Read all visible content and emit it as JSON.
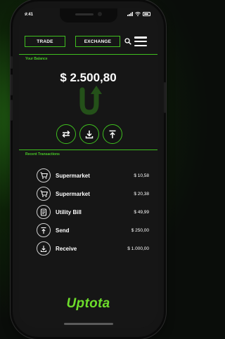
{
  "status_bar": {
    "time": "9:41",
    "signal_icon": "signal-icon",
    "wifi_icon": "wifi-icon",
    "battery_icon": "battery-icon"
  },
  "nav": {
    "trade_label": "TRADE",
    "exchange_label": "EXCHANGE",
    "search_icon": "search-icon",
    "menu_icon": "hamburger-menu-icon"
  },
  "balance": {
    "label": "Your Balance",
    "value": "$ 2.500,80"
  },
  "actions": [
    {
      "icon": "swap-arrows-icon"
    },
    {
      "icon": "download-icon"
    },
    {
      "icon": "upload-icon"
    }
  ],
  "transactions": {
    "label": "Recent Transactions",
    "items": [
      {
        "icon": "shopping-cart-icon",
        "name": "Supermarket",
        "amount": "$ 10,58"
      },
      {
        "icon": "shopping-cart-icon",
        "name": "Supermarket",
        "amount": "$ 20,38"
      },
      {
        "icon": "receipt-icon",
        "name": "Utility Bill",
        "amount": "$ 49,99"
      },
      {
        "icon": "upload-icon",
        "name": "Send",
        "amount": "$ 250,00"
      },
      {
        "icon": "download-icon",
        "name": "Receive",
        "amount": "$ 1.000,00"
      }
    ]
  },
  "brand": {
    "name": "Uptota"
  },
  "colors": {
    "accent": "#3fbf1f",
    "brand": "#6ddd2b",
    "background": "#161616",
    "text": "#ffffff"
  }
}
